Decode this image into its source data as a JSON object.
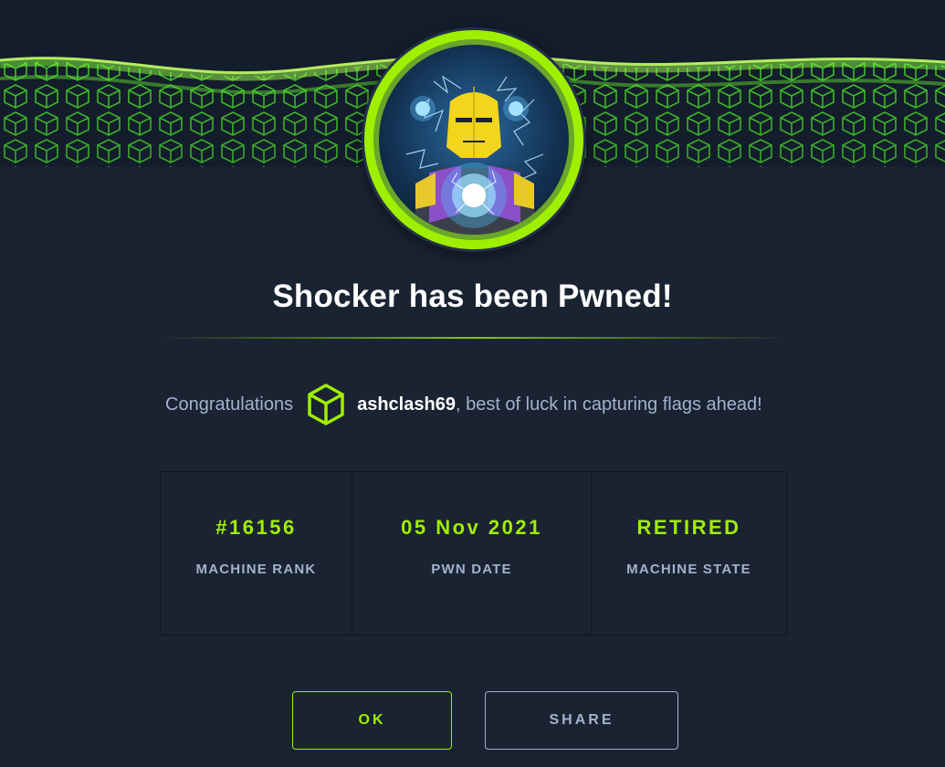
{
  "modal": {
    "title": "Shocker has been Pwned!",
    "congrats_prefix": "Congratulations",
    "username": "ashclash69",
    "congrats_suffix": ", best of luck in capturing flags ahead!",
    "user_icon": "hackthebox-cube-icon",
    "avatar_icon": "shocker-machine-avatar",
    "banner_icon": "green-cube-grid-banner"
  },
  "stats": [
    {
      "value": "#16156",
      "label": "MACHINE RANK"
    },
    {
      "value": "05 Nov 2021",
      "label": "PWN DATE"
    },
    {
      "value": "RETIRED",
      "label": "MACHINE STATE"
    }
  ],
  "buttons": {
    "ok_label": "OK",
    "share_label": "SHARE"
  },
  "colors": {
    "background": "#1a2332",
    "accent": "#9fef00",
    "muted_text": "#a4b1cd",
    "title_text": "#ffffff"
  }
}
